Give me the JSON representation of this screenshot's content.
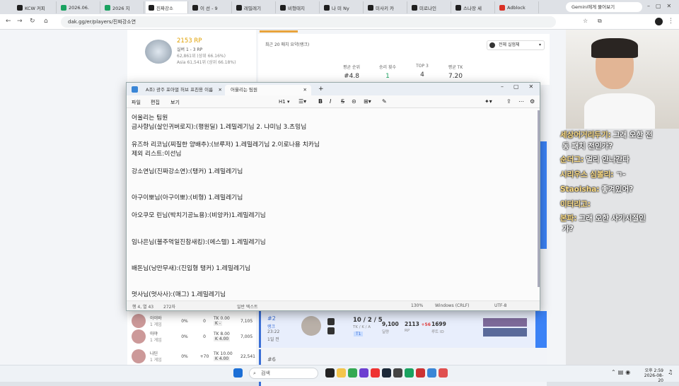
{
  "browser": {
    "tabs": [
      {
        "label": "KCW 커피",
        "color": "#1f1f1f"
      },
      {
        "label": "2026.06.",
        "color": "#1aa260"
      },
      {
        "label": "2026 지",
        "color": "#1aa260"
      },
      {
        "label": "진짜강소",
        "color": "#1f1f1f"
      },
      {
        "label": "이 선 - 9",
        "color": "#1f1f1f"
      },
      {
        "label": "레밀레기",
        "color": "#1f1f1f"
      },
      {
        "label": "비형태지",
        "color": "#1f1f1f"
      },
      {
        "label": "나 미 Ny",
        "color": "#1f1f1f"
      },
      {
        "label": "미사키 카",
        "color": "#1f1f1f"
      },
      {
        "label": "미로나인",
        "color": "#1f1f1f"
      },
      {
        "label": "스나장 세",
        "color": "#1f1f1f"
      },
      {
        "label": "Adblock",
        "color": "#d93025"
      }
    ],
    "gemini_button": "Gemini에게 물어보기",
    "url": "dak.gg/er/players/진짜강소연"
  },
  "profile": {
    "rp": "2153 RP",
    "tier": "실버 1 - 3 RP",
    "rank1": "62,861위 (상위 66.16%)",
    "rank2": "Asia 61,541위 (상위 66.18%)"
  },
  "stats": {
    "summary_label": "최근 20 매치 요약(랭크)",
    "filter": "전체 실험체",
    "avg_rank_label": "평균 순위",
    "avg_rank": "#4.8",
    "wins_label": "승리 횟수",
    "wins": "1",
    "top3_label": "TOP 3",
    "top3": "4",
    "avg_tk_label": "평균 TK",
    "avg_tk": "7.20"
  },
  "ranking_rows": [
    {
      "name": "아이바",
      "games": "1 게임",
      "pct": "0%",
      "val": "0",
      "tk": "TK 0.00",
      "k": "K -",
      "score": "7,105"
    },
    {
      "name": "아야",
      "games": "1 게임",
      "pct": "0%",
      "val": "0",
      "tk": "TK 8.00",
      "k": "K 4.00",
      "score": "7,005"
    },
    {
      "name": "나딘",
      "games": "1 게임",
      "pct": "0%",
      "val": "+70",
      "tk": "TK 10.00",
      "k": "K 4.00",
      "score": "22,541"
    }
  ],
  "match": {
    "place": "#2",
    "mode": "랭크",
    "time": "23:22",
    "ago": "1일 전",
    "kda": "10 / 2 / 5",
    "kda_label": "TK / K / A",
    "t1": "T1",
    "dmg": "9,100",
    "dmg_label": "딜량",
    "rp": "2113",
    "rp_change": "+56",
    "rp_label": "RP",
    "route": "1699",
    "route_label": "루트 ID",
    "place2": "#6"
  },
  "notepad": {
    "tab1": "A조) 광주 포아멀 허브 프친용 이름",
    "tab2": "어울리는 팀원",
    "menu": [
      "파일",
      "편집",
      "보기"
    ],
    "heading": "H1",
    "lines": [
      "어울리는 팀원",
      "금사향님(살인귀버로지):(평원딜)  1.레밀레기님 2. 냐미님 3.츠밍님",
      "유즈하 리코님(찌질한 양배추):(브루저) 1.레밀레기님 2.이로나용 치카님",
      "제외 리스트:이선님",
      "강소연님(진짜강소연):(탱커) 1.레밀레기님",
      "아구이뽀님(아구이뽀):(비형) 1.레밀레기님",
      "아오쿠모 린님(박치기공뇨용):(비앙카)1.레밀레기님",
      "임나은님(불주먹일진참새킹):(에스텔) 1.레밀레기님",
      "배돈님(낭만무새):(진입형 탱커) 1.레밀레기님",
      "멋사님(멋사사):(매그) 1.레밀레기님"
    ],
    "status": {
      "position": "행 4, 열 43",
      "chars": "272자",
      "format": "일반 텍스트",
      "zoom": "130%",
      "eol": "Windows (CRLF)",
      "encoding": "UTF-8"
    }
  },
  "chat": [
    {
      "nick": "세상어거리두기:",
      "msg": "그래 오한 전"
    },
    {
      "nick": "",
      "msg": "동 패치 전인가?"
    },
    {
      "nick": "순더그:",
      "msg": "멀리 안나간다"
    },
    {
      "nick": "시리우스 심볼리:",
      "msg": "ㄱ-"
    },
    {
      "nick": "Staoisha:",
      "msg": "좋겨있어?"
    },
    {
      "nick": "이터리고:",
      "msg": ""
    },
    {
      "nick": "본파:",
      "msg": "그래 오한 사기시절인"
    },
    {
      "nick": "",
      "msg": "가?"
    }
  ],
  "taskbar": {
    "search": "검색",
    "time": "오후 2:59",
    "date": "2026-08-20"
  }
}
